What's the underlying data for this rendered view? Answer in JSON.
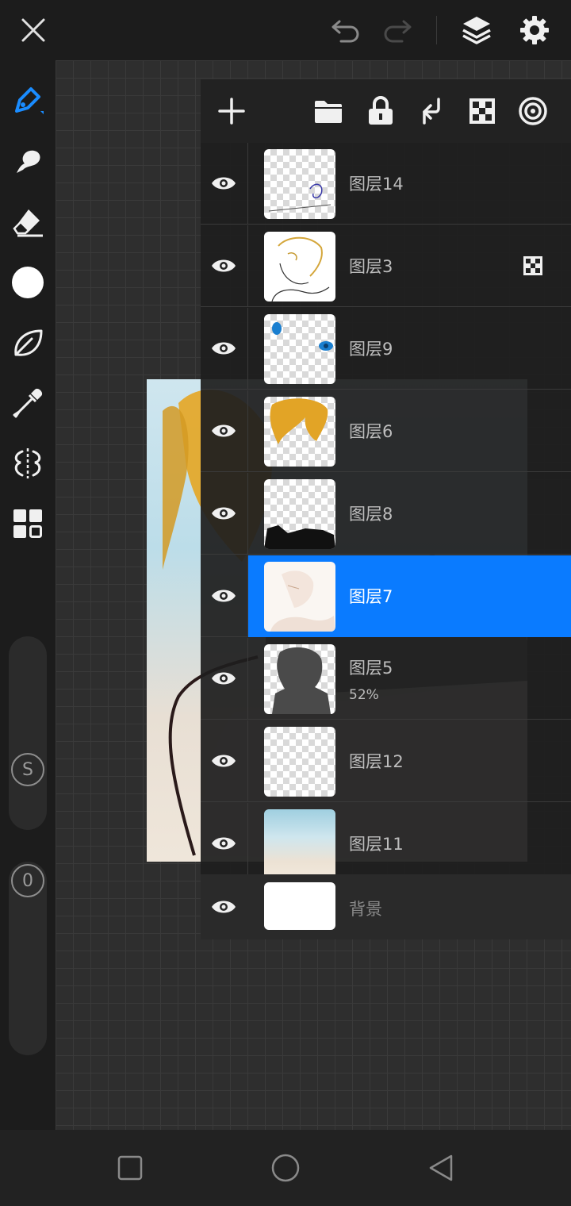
{
  "colors": {
    "accent": "#0a7bff",
    "background": "#1c1c1c",
    "panel": "#1e1e1e",
    "text": "#bdbdbd"
  },
  "topbar": {
    "icons": [
      "close-icon",
      "undo-icon",
      "redo-icon",
      "layers-icon",
      "settings-icon"
    ]
  },
  "left_toolbar": {
    "tools": [
      "pen-icon",
      "smudge-icon",
      "eraser-icon",
      "color-dot-icon",
      "leaf-icon",
      "eyedropper-icon",
      "symmetry-icon",
      "grid-icon"
    ],
    "size_slider_label": "S",
    "opacity_slider_label": "0"
  },
  "layer_panel": {
    "actions": [
      "add-icon",
      "folder-icon",
      "lock-icon",
      "merge-down-icon",
      "checker-icon",
      "spiral-icon"
    ],
    "layers": [
      {
        "name": "图层14",
        "opacity": "",
        "selected": false
      },
      {
        "name": "图层3",
        "opacity": "",
        "selected": false,
        "badge": "checker"
      },
      {
        "name": "图层9",
        "opacity": "",
        "selected": false
      },
      {
        "name": "图层6",
        "opacity": "",
        "selected": false
      },
      {
        "name": "图层8",
        "opacity": "",
        "selected": false
      },
      {
        "name": "图层7",
        "opacity": "",
        "selected": true
      },
      {
        "name": "图层5",
        "opacity": "52%",
        "selected": false
      },
      {
        "name": "图层12",
        "opacity": "",
        "selected": false
      },
      {
        "name": "图层11",
        "opacity": "",
        "selected": false
      }
    ],
    "background_layer": {
      "name": "背景"
    }
  },
  "navbar": {
    "icons": [
      "recent-apps-icon",
      "home-icon",
      "back-icon"
    ]
  }
}
